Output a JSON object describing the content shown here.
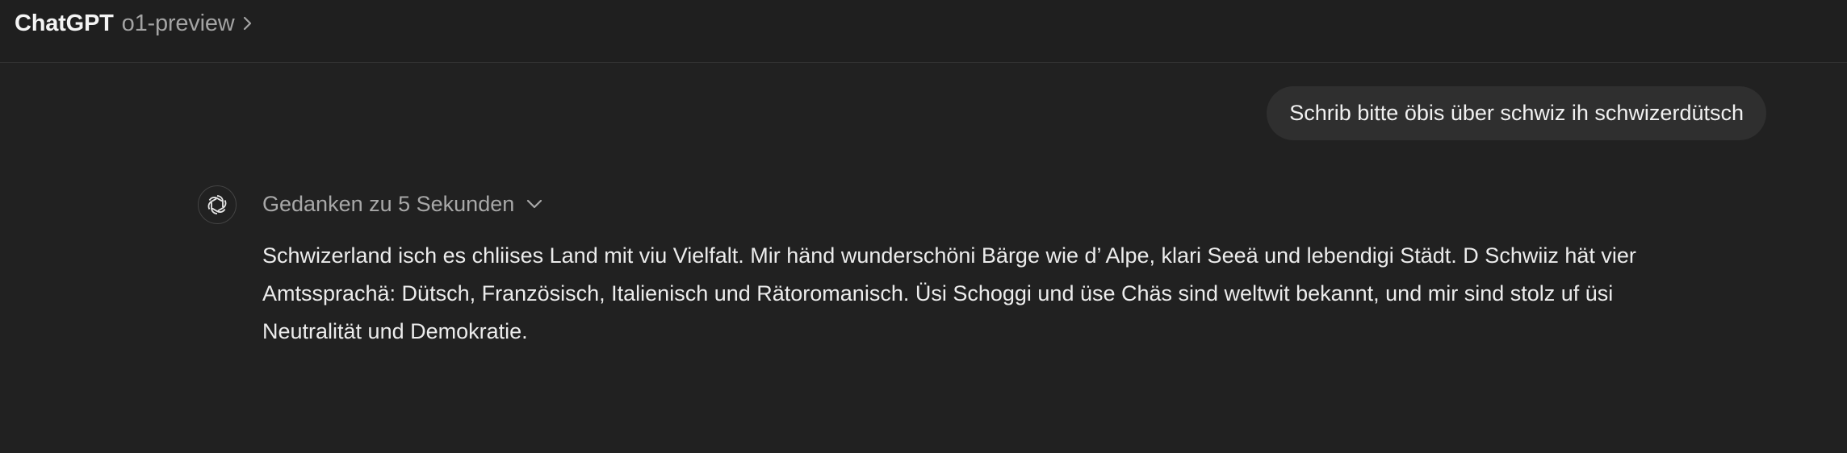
{
  "header": {
    "app_name": "ChatGPT",
    "model_name": "o1-preview",
    "chevron_icon": "chevron-right-icon"
  },
  "conversation": {
    "user_message": "Schrib bitte öbis über schwiz ih schwizerdütsch",
    "assistant": {
      "avatar_icon": "openai-logo-icon",
      "thoughts_label": "Gedanken zu 5 Sekunden",
      "thoughts_chevron_icon": "chevron-down-icon",
      "response": "Schwizerland isch es chliises Land mit viu Vielfalt. Mir händ wunderschöni Bärge wie d’ Alpe, klari Seeä und lebendigi Städt. D Schwiiz hät vier Amtssprachä: Dütsch, Französisch, Italienisch und Rätoromanisch. Üsi Schoggi und üse Chäs sind weltwit bekannt, und mir sind stolz uf üsi Neutralität und Demokratie."
    }
  },
  "colors": {
    "background": "#212121",
    "header_background": "#1f1f1f",
    "bubble_background": "#2f2f2f",
    "muted_text": "#a3a3a3",
    "primary_text": "#ececec"
  }
}
